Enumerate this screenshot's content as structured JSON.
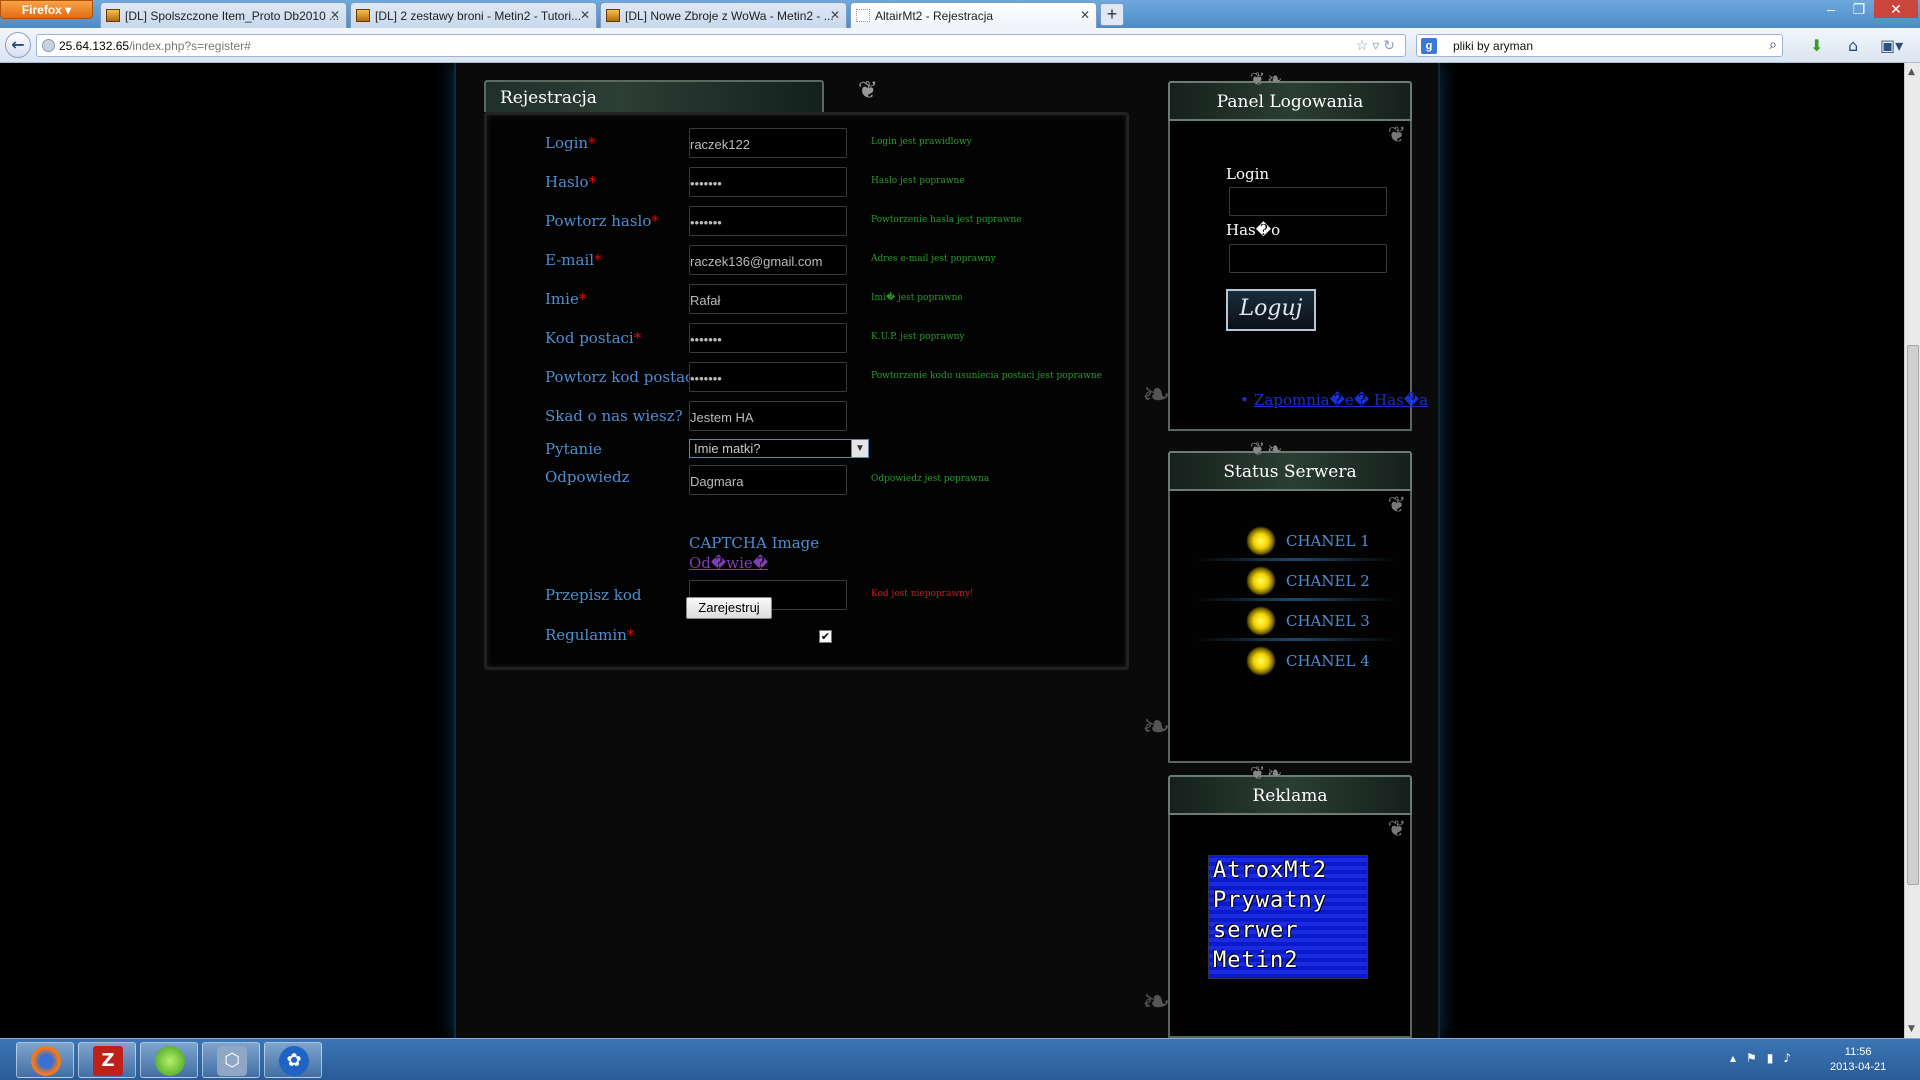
{
  "browser": {
    "menu_label": "Firefox",
    "tabs": [
      {
        "title": "[DL] Spolszczone Item_Proto Db2010 ..."
      },
      {
        "title": "[DL] 2 zestawy broni - Metin2 - Tutori..."
      },
      {
        "title": "[DL] Nowe Zbroje z WoWa - Metin2 - ..."
      },
      {
        "title": "AltairMt2 - Rejestracja"
      }
    ],
    "new_tab": "+",
    "url_host": "25.64.132.65",
    "url_path": "/index.php?s=register#",
    "search_value": "pliki by aryman",
    "window_buttons": {
      "minimize": "–",
      "restore": "❐",
      "close": "✕"
    }
  },
  "registration": {
    "title": "Rejestracja",
    "fields": [
      {
        "label": "Login",
        "required": "*",
        "value": "raczek122",
        "message": "Login jest prawidlowy"
      },
      {
        "label": "Haslo",
        "required": "*",
        "value": "•••••••",
        "message": "Haslo jest poprawne"
      },
      {
        "label": "Powtorz haslo",
        "required": "*",
        "value": "•••••••",
        "message": "Powtorzenie hasla jest poprawne"
      },
      {
        "label": "E-mail",
        "required": "*",
        "value": "raczek136@gmail.com",
        "message": "Adres e-mail jest poprawny"
      },
      {
        "label": "Imie",
        "required": "*",
        "value": "Rafał",
        "message": "Imi� jest poprawne"
      },
      {
        "label": "Kod postaci",
        "required": "*",
        "value": "•••••••",
        "message": "K.U.P. jest poprawny"
      },
      {
        "label": "Powtorz kod postaci",
        "required": "*",
        "value": "•••••••",
        "message": "Powtorzenie kodu usuniecia postaci jest poprawne"
      },
      {
        "label": "Skad o nas wiesz?",
        "required": "",
        "value": "Jestem HA",
        "message": ""
      }
    ],
    "question": {
      "label": "Pytanie",
      "selected": "Imie matki?"
    },
    "answer": {
      "label": "Odpowiedz",
      "value": "Dagmara",
      "message": "Odpowiedz jest poprawna"
    },
    "captcha": {
      "image_alt": "CAPTCHA Image",
      "refresh": "Od�wie�",
      "label": "Przepisz kod",
      "value": "",
      "message": "Kod jest niepoprawny!"
    },
    "terms": {
      "label": "Regulamin",
      "required": "*",
      "checked": "✔"
    },
    "submit": "Zarejestruj"
  },
  "login_panel": {
    "title": "Panel Logowania",
    "login_label": "Login",
    "password_label": "Has�o",
    "button": "Loguj",
    "forgot_bullet": "•",
    "forgot": "Zapomnia�e� Has�a"
  },
  "status_panel": {
    "title": "Status Serwera",
    "channels": [
      {
        "name": "CHANEL 1"
      },
      {
        "name": "CHANEL 2"
      },
      {
        "name": "CHANEL 3"
      },
      {
        "name": "CHANEL 4"
      }
    ]
  },
  "ad_panel": {
    "title": "Reklama",
    "lines": [
      "AtroxMt2",
      "Prywatny",
      "serwer",
      "Metin2"
    ]
  },
  "taskbar": {
    "clock_time": "11:56",
    "clock_date": "2013-04-21"
  }
}
